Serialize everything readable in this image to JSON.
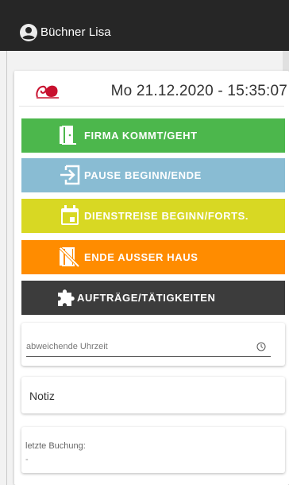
{
  "user": {
    "name": "Büchner Lisa"
  },
  "header": {
    "datetime": "Mo 21.12.2020 - 15:35:07"
  },
  "actions": [
    {
      "label": "FIRMA KOMMT/GEHT",
      "color": "#4cb74c",
      "icon": "door-icon"
    },
    {
      "label": "PAUSE BEGINN/ENDE",
      "color": "#89bcd3",
      "icon": "login-arrow-icon"
    },
    {
      "label": "DIENSTREISE BEGINN/FORTS.",
      "color": "#d8d823",
      "icon": "calendar-icon"
    },
    {
      "label": "ENDE AUSSER HAUS",
      "color": "#ff8c00",
      "icon": "no-door-icon"
    },
    {
      "label": "AUFTRÄGE/TÄTIGKEITEN",
      "color": "#3c3c3c",
      "icon": "puzzle-icon"
    }
  ],
  "time_field": {
    "placeholder": "abweichende Uhrzeit"
  },
  "note_field": {
    "placeholder": "Notiz"
  },
  "last_booking": {
    "label": "letzte Buchung:",
    "value": "-"
  }
}
